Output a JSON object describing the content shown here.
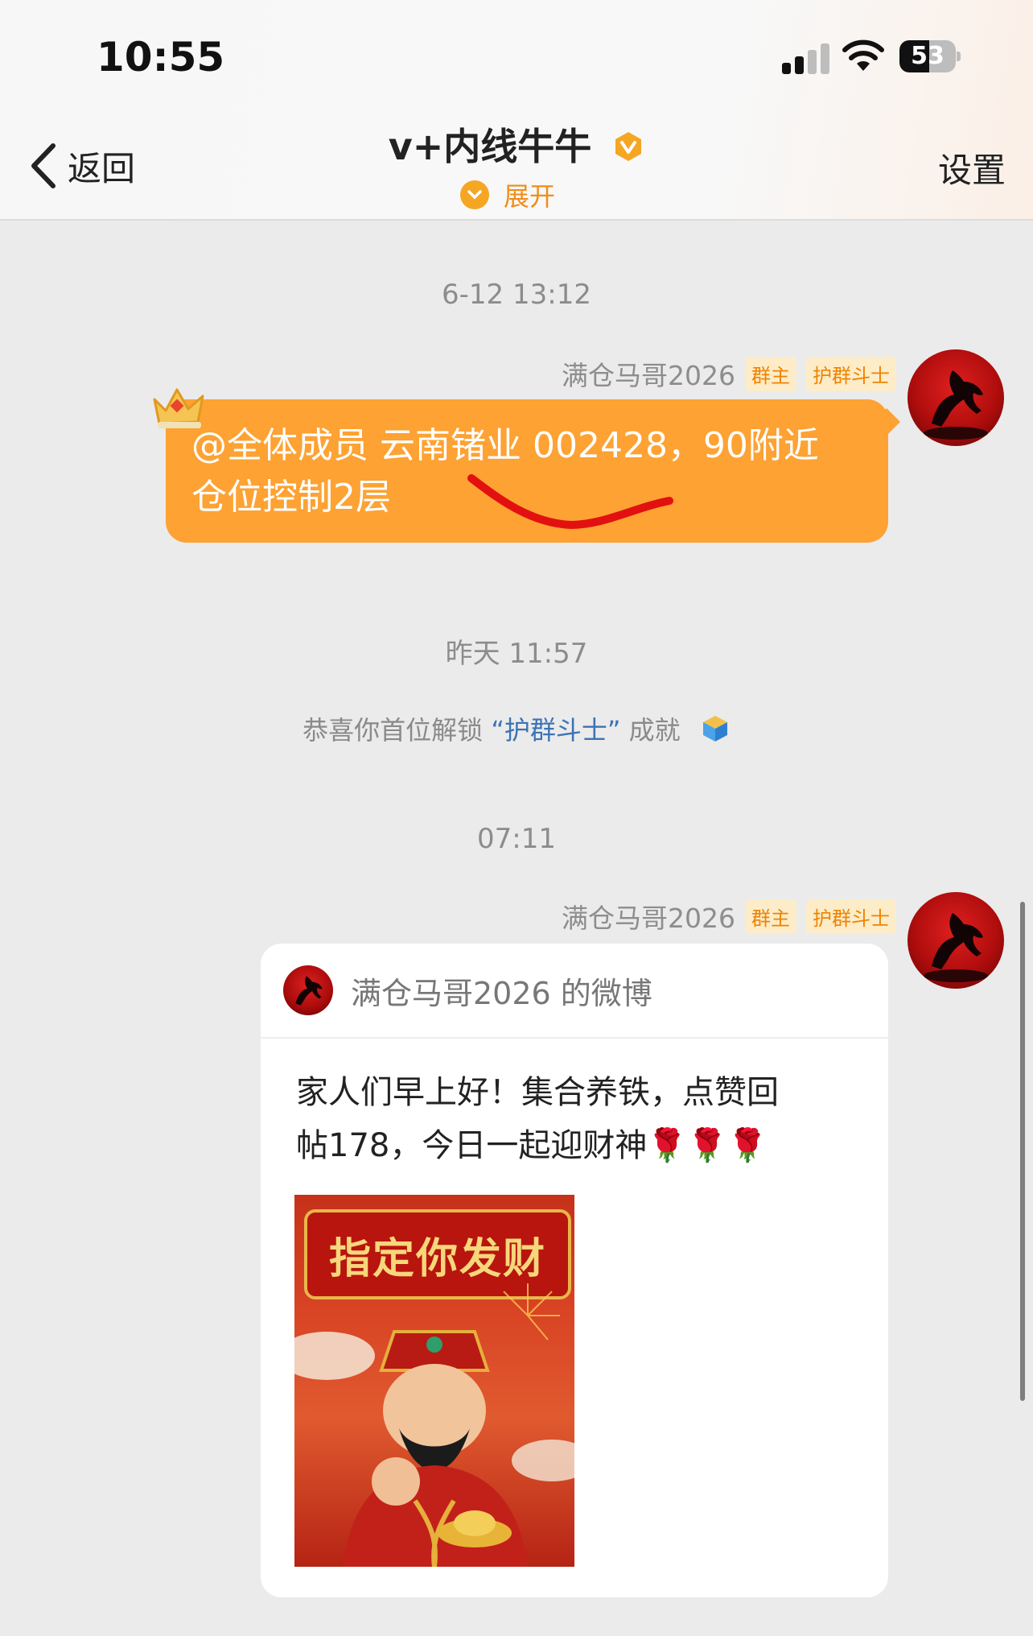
{
  "status_bar": {
    "time": "10:55",
    "battery": "53",
    "battery_level": 0.53
  },
  "nav": {
    "back_label": "返回",
    "title": "v+内线牛牛",
    "expand_label": "展开",
    "settings_label": "设置"
  },
  "messages": [
    {
      "timestamp": "6-12 13:12",
      "sender": "满仓马哥2026",
      "tags": [
        "群主",
        "护群斗士"
      ],
      "line1": "@全体成员 云南锗业 002428，90附近",
      "line2": "仓位控制2层"
    },
    {
      "timestamp": "昨天 11:57",
      "system_prefix": "恭喜你首位解锁",
      "system_highlight": "“护群斗士”",
      "system_suffix": "成就"
    },
    {
      "timestamp": "07:11",
      "sender": "满仓马哥2026",
      "tags": [
        "群主",
        "护群斗士"
      ],
      "card_title": "满仓马哥2026 的微博",
      "card_line1": "家人们早上好！集合养铁，点赞回",
      "card_line2": "帖178，今日一起迎财神🌹🌹🌹",
      "image_banner": "指定你发财"
    }
  ],
  "colors": {
    "accent": "#fda233",
    "link": "#3c73b5",
    "tag_text": "#f08300",
    "tag_bg": "#fdecc8"
  }
}
